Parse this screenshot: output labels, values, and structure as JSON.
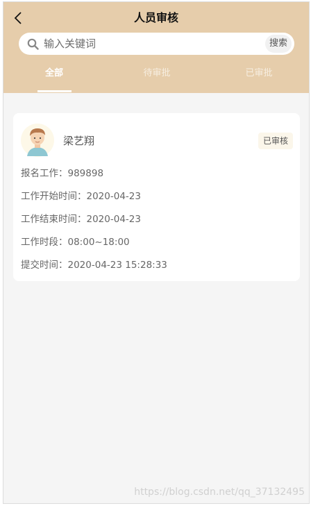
{
  "header": {
    "title": "人员审核"
  },
  "search": {
    "placeholder": "输入关键词",
    "button_label": "搜索"
  },
  "tabs": [
    {
      "label": "全部",
      "active": true
    },
    {
      "label": "待审批",
      "active": false
    },
    {
      "label": "已审批",
      "active": false
    }
  ],
  "card": {
    "name": "梁艺翔",
    "status": "已审核",
    "rows": [
      {
        "label": "报名工作：",
        "value": "989898"
      },
      {
        "label": "工作开始时间：",
        "value": "2020-04-23"
      },
      {
        "label": "工作结束时间：",
        "value": "2020-04-23"
      },
      {
        "label": "工作时段：",
        "value": "08:00~18:00"
      },
      {
        "label": "提交时间：",
        "value": "2020-04-23 15:28:33"
      }
    ]
  },
  "watermark": "https://blog.csdn.net/qq_37132495",
  "colors": {
    "header_bg": "#e6cdab",
    "page_bg": "#f5f5f5",
    "badge_bg": "#fbf6ea"
  },
  "icons": [
    "back-arrow-icon",
    "search-icon",
    "user-avatar-icon"
  ]
}
